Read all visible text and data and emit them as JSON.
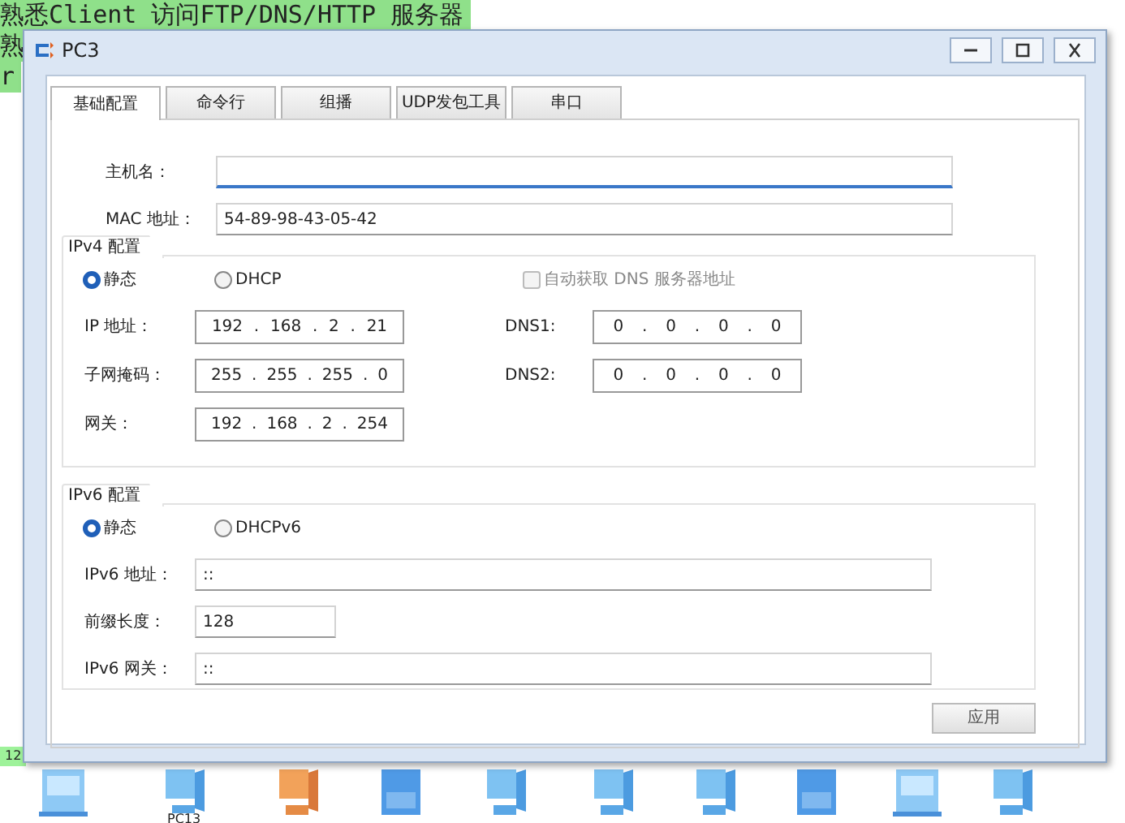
{
  "canvas": {
    "banner_lines": [
      "熟悉Client 访问FTP/DNS/HTTP 服务器",
      "熟",
      "r"
    ],
    "device_label": "PC13",
    "link_badge": "12",
    "devices": [
      {
        "kind": "server"
      },
      {
        "kind": "pc"
      },
      {
        "kind": "pc_orange"
      },
      {
        "kind": "dns"
      },
      {
        "kind": "pc"
      },
      {
        "kind": "pc"
      },
      {
        "kind": "pc"
      },
      {
        "kind": "dns"
      },
      {
        "kind": "server"
      },
      {
        "kind": "pc"
      }
    ]
  },
  "window": {
    "title": "PC3"
  },
  "tabs": [
    {
      "label": "基础配置",
      "selected": true
    },
    {
      "label": "命令行",
      "selected": false
    },
    {
      "label": "组播",
      "selected": false
    },
    {
      "label": "UDP发包工具",
      "selected": false
    },
    {
      "label": "串口",
      "selected": false
    }
  ],
  "host_name": {
    "label": "主机名：",
    "focused": true
  },
  "mac": {
    "label": "MAC 地址：",
    "value": "54-89-98-43-05-42"
  },
  "ipv4": {
    "title": "IPv4 配置",
    "octet_separator": ".",
    "modes": [
      {
        "label": "静态",
        "selected": true
      },
      {
        "label": "DHCP",
        "selected": false
      }
    ],
    "auto_dns": {
      "label": "自动获取 DNS 服务器地址",
      "checked": false,
      "disabled": true
    },
    "fields": [
      {
        "label": "IP 地址：",
        "octets": [
          "192",
          "168",
          "2",
          "21"
        ]
      },
      {
        "label": "子网掩码：",
        "octets": [
          "255",
          "255",
          "255",
          "0"
        ]
      },
      {
        "label": "网关：",
        "octets": [
          "192",
          "168",
          "2",
          "254"
        ]
      }
    ],
    "dns": [
      {
        "label": "DNS1:",
        "octets": [
          "0",
          "0",
          "0",
          "0"
        ]
      },
      {
        "label": "DNS2:",
        "octets": [
          "0",
          "0",
          "0",
          "0"
        ]
      }
    ]
  },
  "ipv6": {
    "title": "IPv6 配置",
    "modes": [
      {
        "label": "静态",
        "selected": true
      },
      {
        "label": "DHCPv6",
        "selected": false
      }
    ],
    "fields": [
      {
        "label": "IPv6 地址：",
        "value": "::",
        "kind": "wide"
      },
      {
        "label": "前缀长度：",
        "value": "128",
        "kind": "short"
      },
      {
        "label": "IPv6 网关：",
        "value": "::",
        "kind": "wide"
      }
    ]
  },
  "apply_button": "应用"
}
